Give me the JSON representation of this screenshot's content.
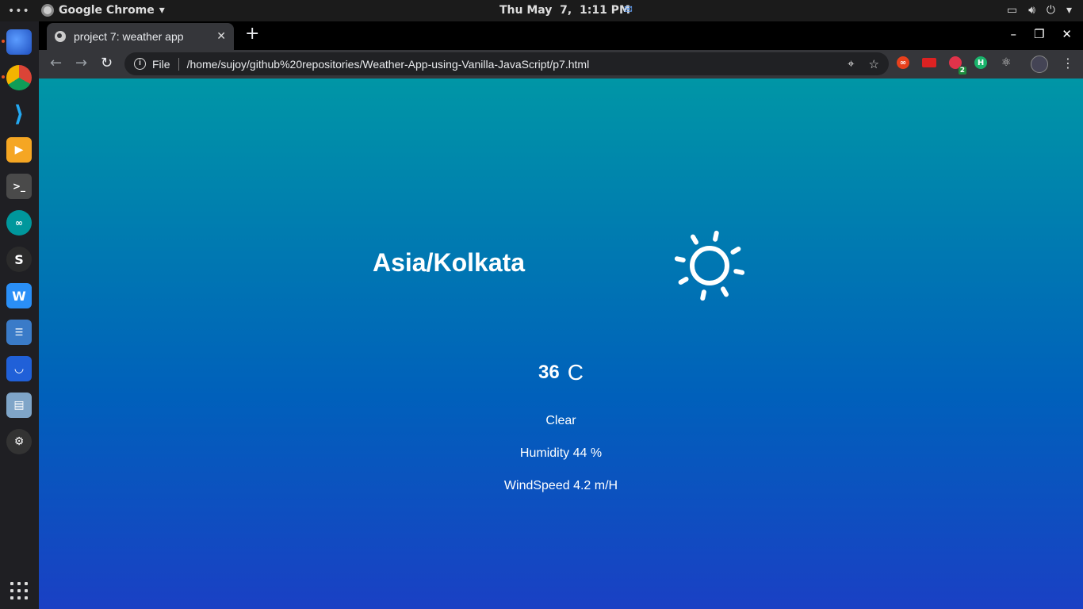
{
  "topbar": {
    "app_name": "Google Chrome",
    "clock": "Thu May  7,  1:11 PM"
  },
  "browser": {
    "tab_title": "project 7: weather app",
    "url_scheme": "File",
    "url": "/home/sujoy/github%20repositories/Weather-App-using-Vanilla-JavaScript/p7.html",
    "extension_badge": "2",
    "extension_h_label": "H"
  },
  "dock": {
    "items": [
      "firefox-icon",
      "chrome-icon",
      "vscode-icon",
      "media-player-icon",
      "terminal-icon",
      "arduino-icon",
      "s-app-icon",
      "wps-writer-icon",
      "settings-icon",
      "software-store-icon",
      "screen-icon",
      "steam-icon"
    ],
    "s_app_label": "S"
  },
  "page": {
    "timezone": "Asia/Kolkata",
    "weather_icon": "clear-day-sun-icon",
    "temperature_value": "36",
    "temperature_unit": "C",
    "description": "Clear",
    "humidity": "Humidity 44 %",
    "windspeed": "WindSpeed 4.2 m/H"
  }
}
